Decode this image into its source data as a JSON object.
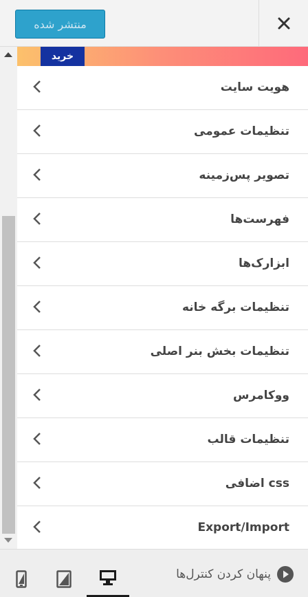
{
  "header": {
    "publish_label": "منتشر شده",
    "close_icon": "close-icon"
  },
  "banner": {
    "buy_label": "خرید"
  },
  "menu": {
    "items": [
      {
        "label": "هویت سایت"
      },
      {
        "label": "تنظیمات عمومی"
      },
      {
        "label": "تصویر پس‌زمینه"
      },
      {
        "label": "فهرست‌ها"
      },
      {
        "label": "ابزارک‌ها"
      },
      {
        "label": "تنظیمات برگه خانه"
      },
      {
        "label": "تنظیمات بخش بنر اصلی"
      },
      {
        "label": "ووکامرس"
      },
      {
        "label": "تنظیمات قالب"
      },
      {
        "label": "css اضافی"
      },
      {
        "label": "Export/Import"
      }
    ]
  },
  "footer": {
    "hide_controls_label": "پنهان کردن کنترل‌ها",
    "devices": [
      "desktop",
      "tablet",
      "mobile"
    ],
    "active_device": "desktop"
  },
  "colors": {
    "publish_bg": "#2ea2cc",
    "buy_bg": "#1432a0",
    "banner_start": "#fcc16c",
    "banner_end": "#fe6a7b"
  }
}
